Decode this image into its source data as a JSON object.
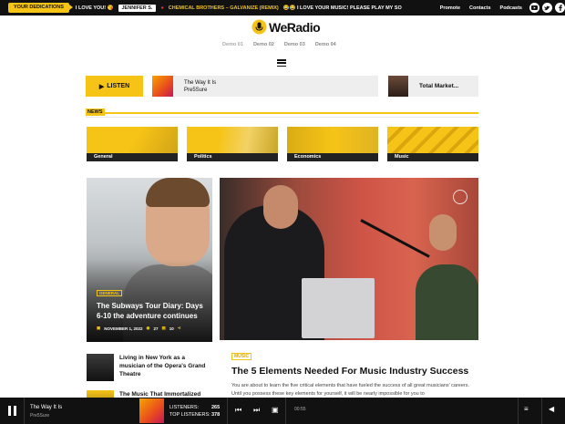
{
  "topbar": {
    "dedications_label": "YOUR DEDICATIONS",
    "ticker_msg1": "I LOVE YOU! 😘",
    "ticker_name": "JENNIFER S.",
    "ticker_song": "CHEMICAL BROTHERS – GALVANIZE (REMIX)",
    "ticker_msg2": "😂😂 I LOVE YOUR MUSIC! PLEASE PLAY MY SO",
    "nav": [
      "Promote",
      "Contacts",
      "Podcasts"
    ]
  },
  "logo": {
    "text": "WeRadio"
  },
  "demos": [
    "Demo 01",
    "Demo 02",
    "Demo 03",
    "Demo 04"
  ],
  "player_strip": {
    "listen_label": "LISTEN",
    "song_title": "The Way It Is",
    "song_artist": "Pre5Sure",
    "podcast_title": "Total Market..."
  },
  "news": {
    "label": "NEWS",
    "categories": [
      "General",
      "Politics",
      "Economics",
      "Music"
    ]
  },
  "featured_left": {
    "tag": "GENERAL",
    "title": "The Subways Tour Diary: Days 6-10 the adventure continues",
    "date": "NOVEMBER 1, 2022",
    "views": "27",
    "comments": "10"
  },
  "list_items": [
    {
      "title": "Living in New York as a musician of the Opera's Grand Theatre"
    },
    {
      "title": "The Music That Immortalized"
    }
  ],
  "article": {
    "tag": "MUSIC",
    "title": "The 5 Elements Needed For Music Industry Success",
    "text": "You are about to learn the five critical elements that have fueled the success of all great musicians' careers. Until you possess these key elements for yourself, it will be nearly impossible for you to"
  },
  "bottom_player": {
    "title": "The Way It Is",
    "artist": "Pre5Sure",
    "listeners_label": "LISTENERS:",
    "listeners_value": "265",
    "top_listeners_label": "TOP LISTENERS:",
    "top_listeners_value": "378",
    "time": "00:55"
  },
  "colors": {
    "accent": "#f6c417",
    "dark": "#111111"
  }
}
